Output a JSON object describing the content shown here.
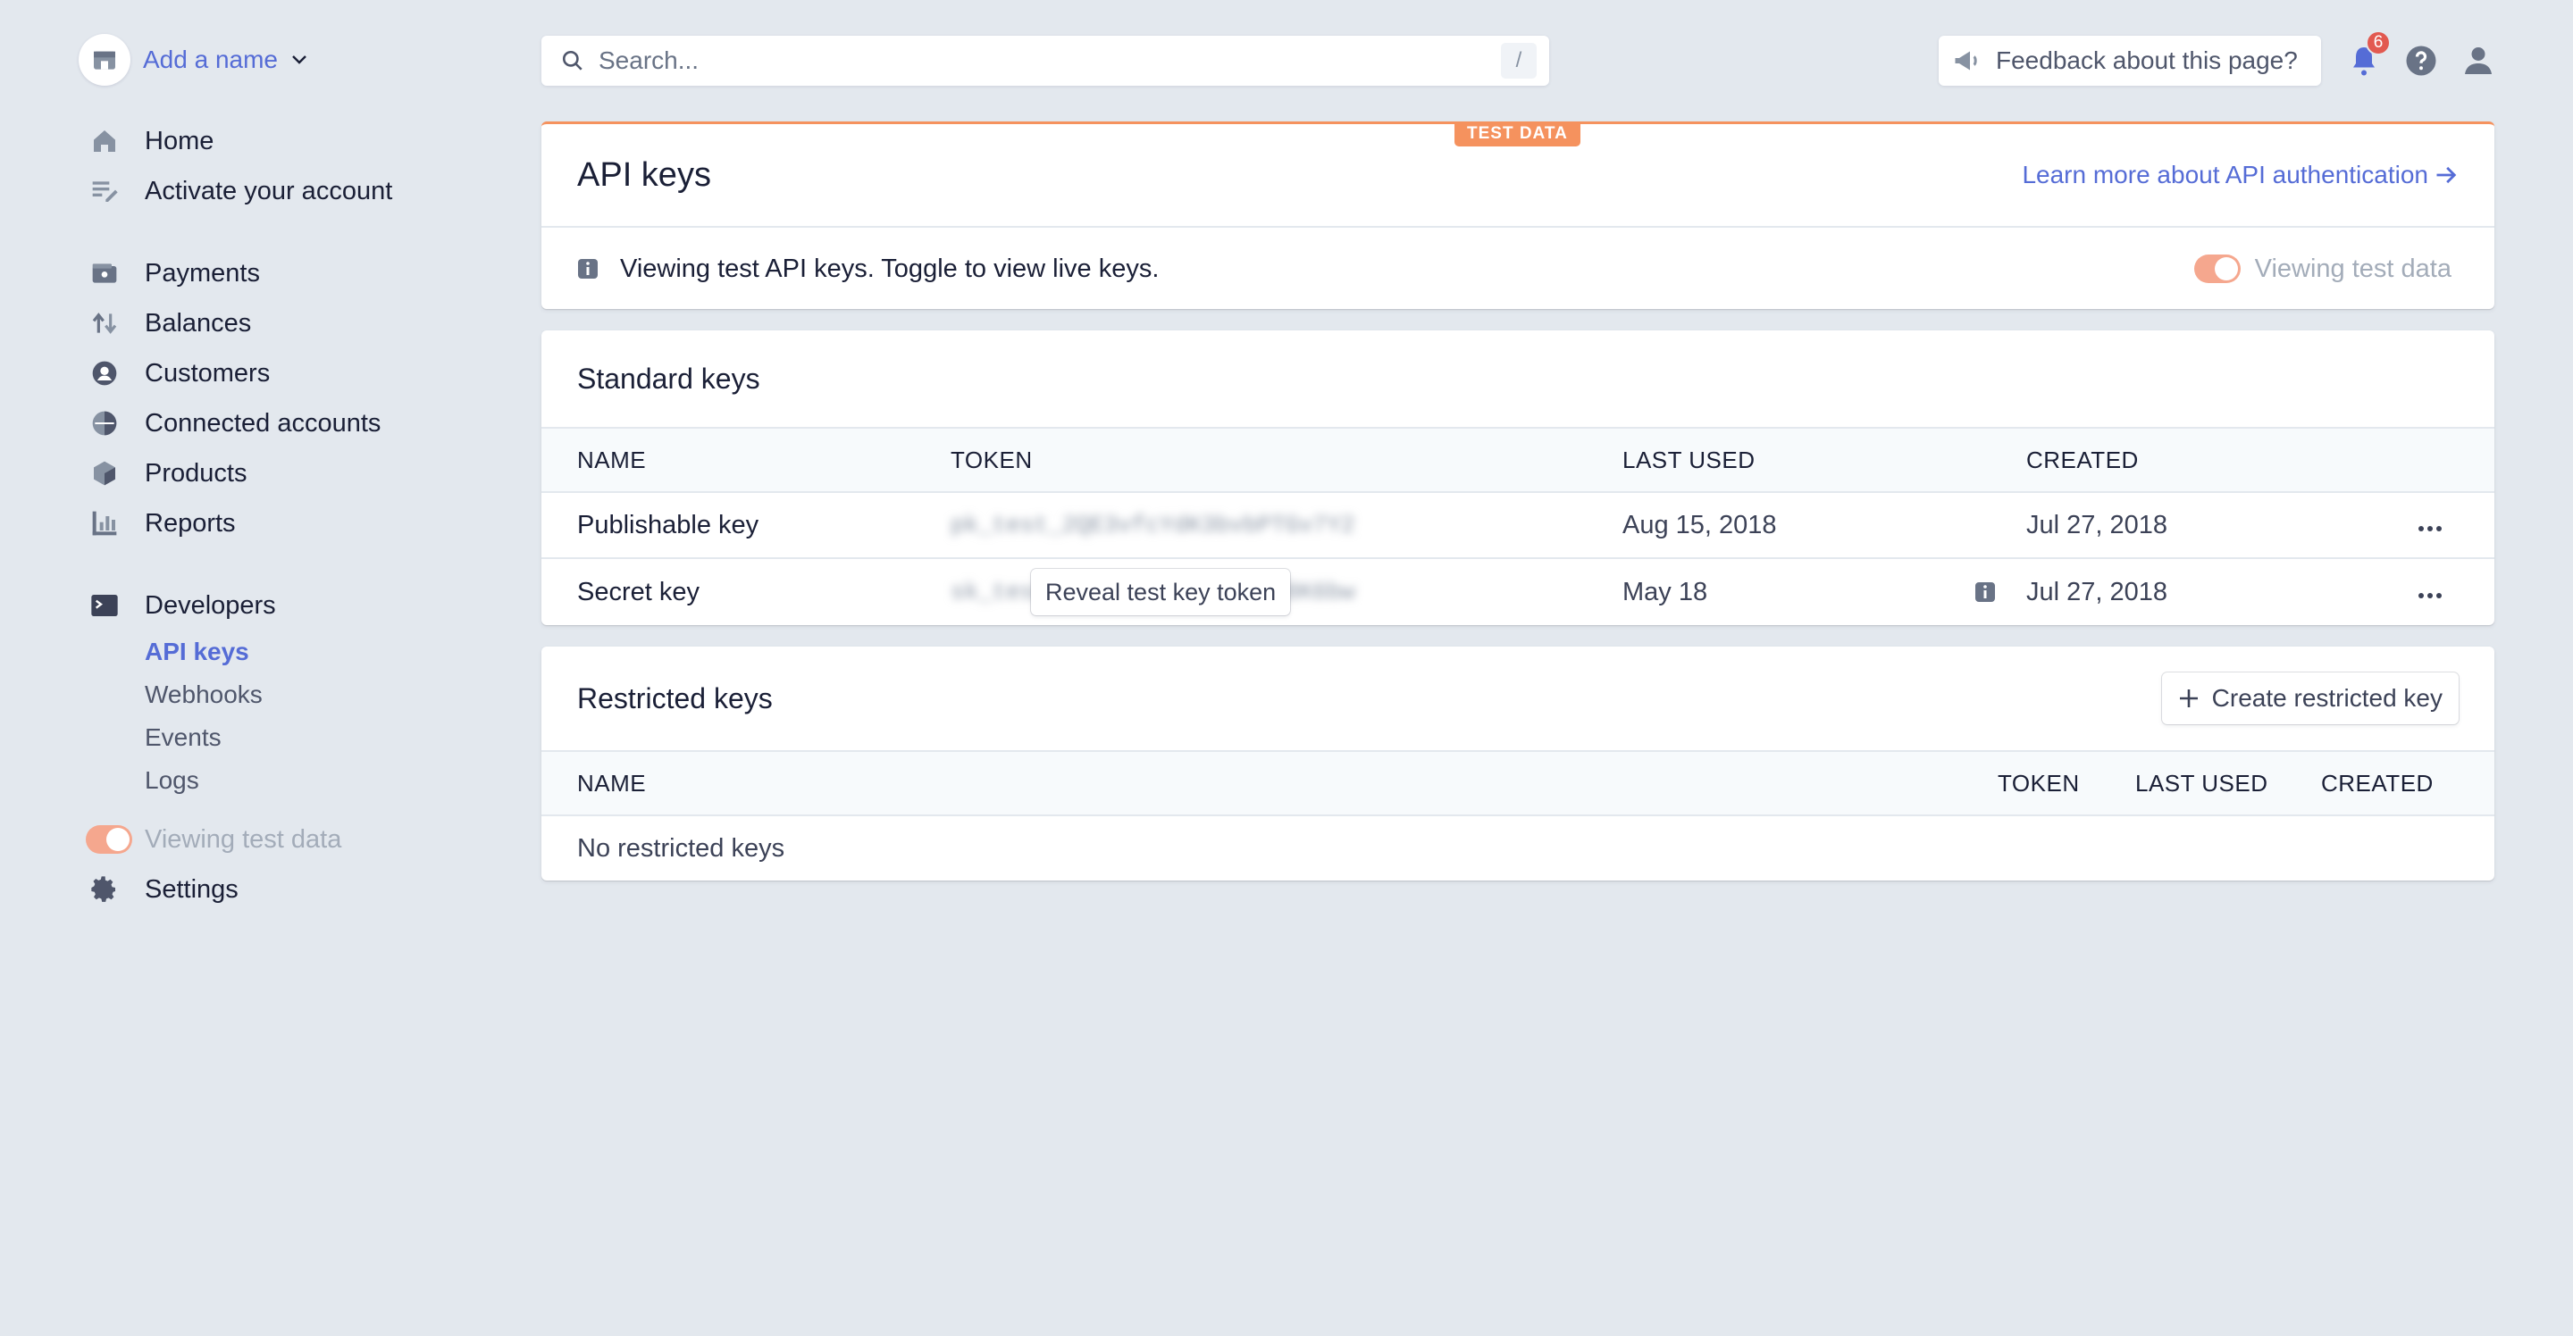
{
  "sidebar": {
    "account_name": "Add a name",
    "primary": [
      {
        "label": "Home",
        "icon": "home-icon"
      },
      {
        "label": "Activate your account",
        "icon": "checklist-icon"
      }
    ],
    "main": [
      {
        "label": "Payments",
        "icon": "wallet-icon"
      },
      {
        "label": "Balances",
        "icon": "transfer-arrows-icon"
      },
      {
        "label": "Customers",
        "icon": "person-circle-icon"
      },
      {
        "label": "Connected accounts",
        "icon": "globe-icon"
      },
      {
        "label": "Products",
        "icon": "box-icon"
      },
      {
        "label": "Reports",
        "icon": "bar-chart-icon"
      }
    ],
    "developers": {
      "label": "Developers",
      "icon": "terminal-icon",
      "items": [
        {
          "label": "API keys",
          "active": true
        },
        {
          "label": "Webhooks"
        },
        {
          "label": "Events"
        },
        {
          "label": "Logs"
        }
      ]
    },
    "test_toggle_label": "Viewing test data",
    "settings_label": "Settings"
  },
  "topbar": {
    "search_placeholder": "Search...",
    "search_shortcut": "/",
    "feedback_label": "Feedback about this page?",
    "notification_count": "6"
  },
  "api_card": {
    "badge": "TEST DATA",
    "title": "API keys",
    "learn_link": "Learn more about API authentication",
    "info_text": "Viewing test API keys. Toggle to view live keys.",
    "toggle_label": "Viewing test data"
  },
  "standard_keys": {
    "title": "Standard keys",
    "columns": [
      "NAME",
      "TOKEN",
      "LAST USED",
      "CREATED"
    ],
    "rows": [
      {
        "name": "Publishable key",
        "token": "pk_test_2QE3vfcYdK3bvbPTGv7Y2",
        "last_used": "Aug 15, 2018",
        "created": "Jul 27, 2018"
      },
      {
        "name": "Secret key",
        "token": "sk_test_aB8hc4hRhwJ9vD1c8K6bw",
        "last_used": "May 18",
        "created": "Jul 27, 2018",
        "reveal_label": "Reveal test key token"
      }
    ]
  },
  "restricted_keys": {
    "title": "Restricted keys",
    "create_label": "Create restricted key",
    "columns": [
      "NAME",
      "TOKEN",
      "LAST USED",
      "CREATED"
    ],
    "empty_text": "No restricted keys"
  },
  "colors": {
    "accent": "#556cd6",
    "test_orange": "#f5925e",
    "background": "#e3e8ee"
  }
}
